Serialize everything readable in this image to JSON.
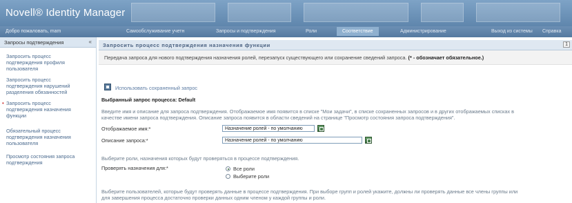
{
  "app": {
    "title": "Novell® Identity Manager"
  },
  "nav": {
    "welcome": "Добро пожаловать, mam",
    "tabs": [
      {
        "label": "Самообслуживание учетн"
      },
      {
        "label": "Запросы и подтверждения"
      },
      {
        "label": "Роли"
      },
      {
        "label": "Соответствие"
      },
      {
        "label": "Администрирование"
      },
      {
        "label": "Выход из системы"
      },
      {
        "label": "Справка"
      }
    ]
  },
  "sidebar": {
    "header": "Запросы подтверждения",
    "collapse_icon": "«",
    "items": [
      {
        "label_1": "Запросить процесс",
        "label_2": "подтверждения профиля",
        "label_3": "пользователя"
      },
      {
        "label_1": "Запросить процесс",
        "label_2": "подтверждения нарушений",
        "label_3": "разделения обязанностей"
      },
      {
        "label_1": "Запросить процесс",
        "label_2": "подтверждения назначения",
        "label_3": "функции",
        "active": true
      },
      {
        "label_1": "Обязательный процесс",
        "label_2": "подтверждения назначения",
        "label_3": "пользователя"
      },
      {
        "label_1": "Просмотр состояния запроса",
        "label_2": "подтверждения"
      }
    ]
  },
  "main": {
    "header": "Запросить процесс подтверждения назначения функции",
    "header_badge": "1",
    "info_text": "Передача запроса для нового подтверждения назначения ролей, перезапуск существующего или сохранение сведений запроса.",
    "info_required": "(* - обозначает обязательное.)",
    "saved_link": "Использовать сохраненный запрос",
    "selected_label": "Выбранный запрос процесса: Default",
    "desc_line1": "Введите имя и описание для запроса подтверждения. Отображаемое имя появится в списке \"Мои задачи\", в списке сохраненных запросов и в других отображаемых списках в",
    "desc_line2": "качестве имени запроса подтверждения. Описание запроса появится в области сведений на странице \"Просмотр состояния запроса подтверждения\".",
    "name_label": "Отображаемое имя:*",
    "name_value": "Назначение ролей - по умолчанию",
    "desc_label": "Описание запроса:*",
    "desc_value": "Назначение ролей - по умолчанию",
    "roles_hint": "Выберите роли, назначения которых будут проверяться в процессе подтверждения.",
    "check_label": "Проверять назначения для:*",
    "radio_all": "Все роли",
    "radio_select": "Выберите роли",
    "users_line1": "Выберите пользователей, которые будут проверять данные в процессе подтверждения. При выборе групп и ролей укажите, должны ли проверять данные все члены группы или",
    "users_line2": "для завершения процесса достаточно проверки данных одним членом у каждой группы и роли."
  }
}
